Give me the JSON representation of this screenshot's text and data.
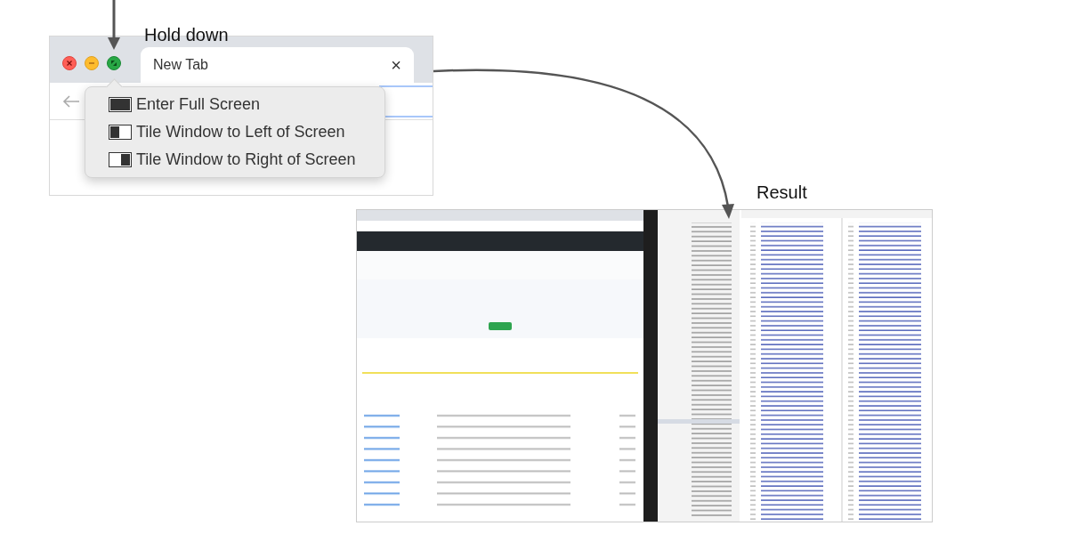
{
  "labels": {
    "hold": "Hold down",
    "result": "Result"
  },
  "chrome_window": {
    "tab_title": "New Tab",
    "tab_close": "×",
    "menu": [
      {
        "kind": "full",
        "label": "Enter Full Screen"
      },
      {
        "kind": "left",
        "label": "Tile Window to Left of Screen"
      },
      {
        "kind": "right",
        "label": "Tile Window to Right of Screen"
      }
    ]
  }
}
